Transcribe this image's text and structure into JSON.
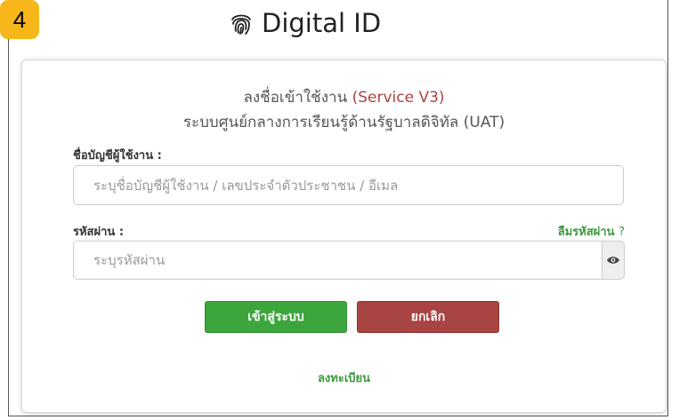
{
  "badge": {
    "number": "4"
  },
  "header": {
    "logo_text": "Digital ID"
  },
  "login": {
    "title_prefix": "ลงชื่อเข้าใช้งาน",
    "title_service": "(Service V3)",
    "subtitle": "ระบบศูนย์กลางการเรียนรู้ด้านรัฐบาลดิจิทัล (UAT)",
    "username_label": "ชื่อบัญชีผู้ใช้งาน :",
    "username_placeholder": "ระบุชื่อบัญชีผู้ใช้งาน / เลขประจำตัวประชาชน / อีเมล",
    "password_label": "รหัสผ่าน :",
    "forgot_label": "ลืมรหัสผ่าน",
    "forgot_q": "?",
    "password_placeholder": "ระบุรหัสผ่าน",
    "login_button": "เข้าสู่ระบบ",
    "cancel_button": "ยกเลิก",
    "register_link": "ลงทะเบียน"
  },
  "colors": {
    "badge": "#f7b619",
    "service_accent": "#a94442",
    "login_button": "#3ca63c",
    "cancel_button": "#a84442",
    "link_green": "#3c9a3c"
  },
  "icons": {
    "logo": "fingerprint-icon",
    "toggle_password": "eye-icon"
  }
}
